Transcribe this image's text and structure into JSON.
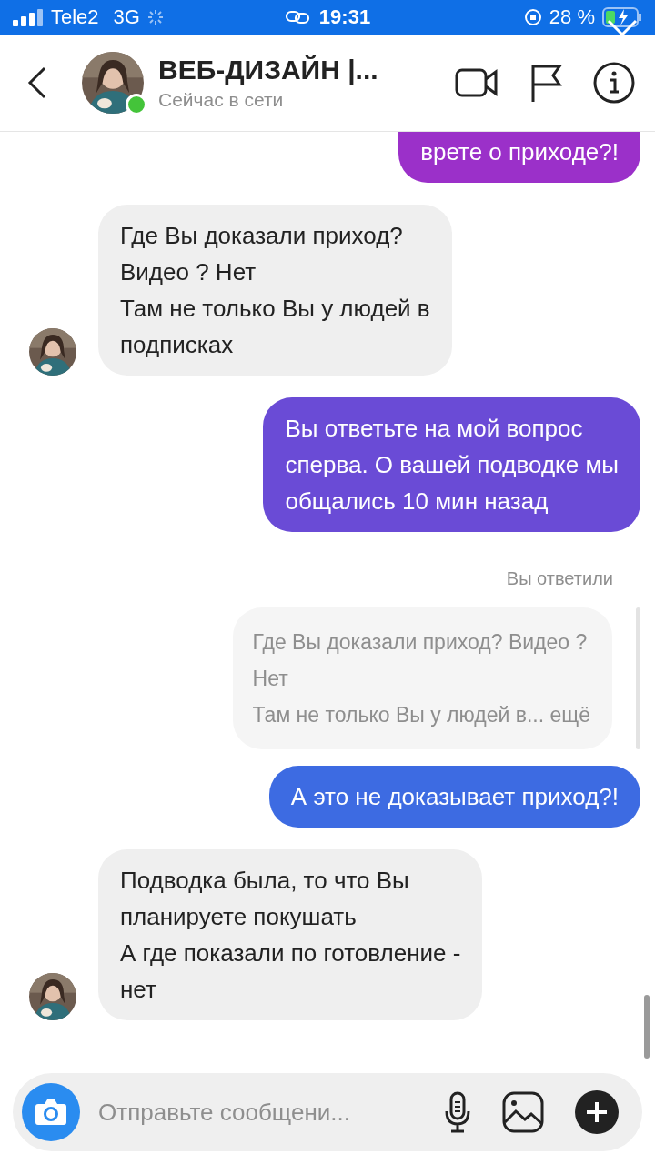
{
  "status_bar": {
    "carrier": "Tele2",
    "network": "3G",
    "time": "19:31",
    "battery": "28 %"
  },
  "header": {
    "title": "ВЕБ-ДИЗАЙН |...",
    "status": "Сейчас в сети",
    "online": true
  },
  "messages": [
    {
      "kind": "sent",
      "text": "врете о приходе?!",
      "color": "#9b30c9",
      "top_cut": true
    },
    {
      "kind": "received",
      "text": "Где Вы доказали приход?\nВидео ? Нет\nТам не только Вы у людей в\nподписках"
    },
    {
      "kind": "sent",
      "text": "Вы ответьте на мой вопрос\nсперва. О вашей подводке мы\nобщались 10 мин назад",
      "color": "#6a4bd6"
    },
    {
      "kind": "reply",
      "label": "Вы ответили",
      "text": "Где Вы доказали приход? Видео ?\nНет\nТам не только Вы у людей в... ещё"
    },
    {
      "kind": "sent",
      "text": "А это не доказывает приход?!",
      "color": "#3d6be2"
    },
    {
      "kind": "received",
      "text": "Подводка была, то что Вы\nпланируете покушать\nА где показали по готовление -\nнет"
    }
  ],
  "composer": {
    "placeholder": "Отправьте сообщени..."
  }
}
